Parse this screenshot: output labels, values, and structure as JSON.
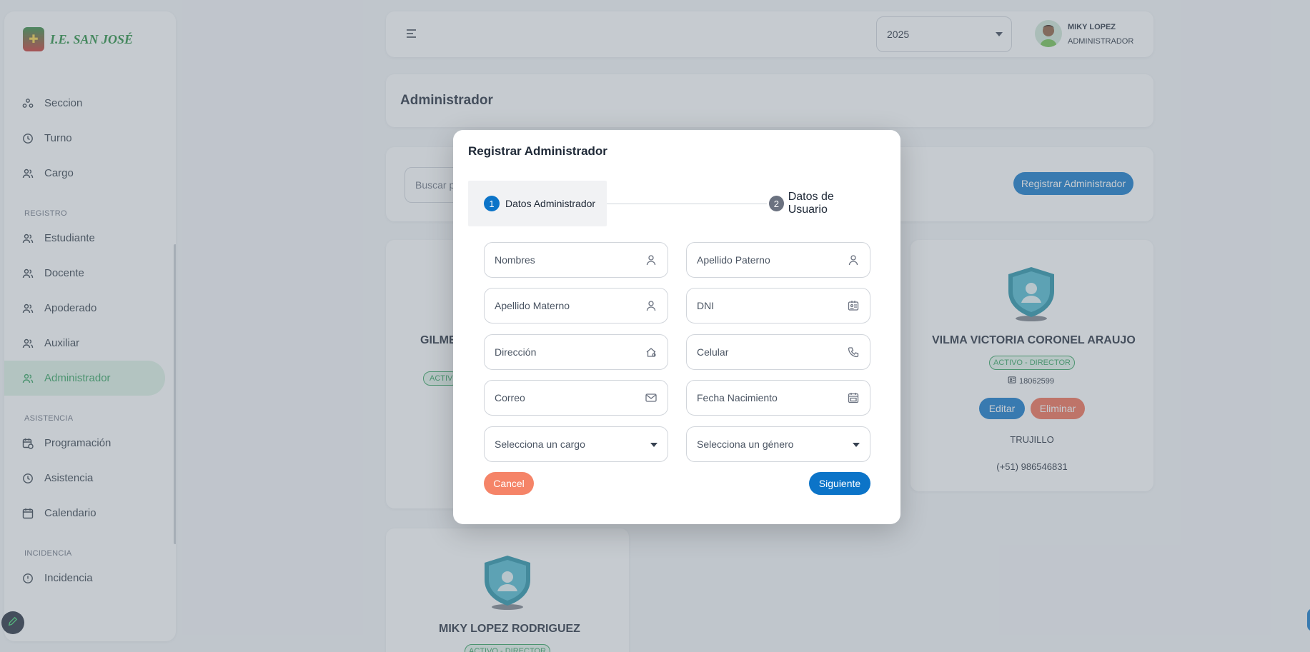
{
  "brand": {
    "name": "I.E. SAN JOSÉ"
  },
  "sidebar": {
    "items_top": [
      {
        "label": "Seccion",
        "icon": "section-icon"
      },
      {
        "label": "Turno",
        "icon": "clock-icon"
      },
      {
        "label": "Cargo",
        "icon": "users-icon"
      }
    ],
    "section_registro": "REGISTRO",
    "items_registro": [
      {
        "label": "Estudiante",
        "icon": "users-icon"
      },
      {
        "label": "Docente",
        "icon": "users-icon"
      },
      {
        "label": "Apoderado",
        "icon": "users-icon"
      },
      {
        "label": "Auxiliar",
        "icon": "users-icon"
      },
      {
        "label": "Administrador",
        "icon": "users-icon",
        "active": true
      }
    ],
    "section_asistencia": "ASISTENCIA",
    "items_asistencia": [
      {
        "label": "Programación",
        "icon": "calendar-clock-icon"
      },
      {
        "label": "Asistencia",
        "icon": "clock-icon"
      },
      {
        "label": "Calendario",
        "icon": "calendar-icon"
      }
    ],
    "section_incidencia": "INCIDENCIA",
    "items_incidencia": [
      {
        "label": "Incidencia",
        "icon": "alert-icon"
      }
    ]
  },
  "header": {
    "year": "2025",
    "user_name": "MIKY LOPEZ",
    "user_role": "ADMINISTRADOR"
  },
  "page": {
    "title": "Administrador",
    "search_placeholder": "Buscar por",
    "register_button": "Registrar Administrador"
  },
  "cards": [
    {
      "name": "GILME",
      "badge": "ACTIV"
    },
    {
      "name": "VILMA VICTORIA CORONEL ARAUJO",
      "badge": "ACTIVO - DIRECTOR",
      "dni": "18062599",
      "edit": "Editar",
      "delete": "Eliminar",
      "city": "TRUJILLO",
      "phone": "(+51) 986546831"
    },
    {
      "name": "MIKY LOPEZ RODRIGUEZ",
      "badge": "ACTIVO - DIRECTOR"
    }
  ],
  "modal": {
    "title": "Registrar Administrador",
    "step1": {
      "num": "1",
      "label": "Datos Administrador"
    },
    "step2": {
      "num": "2",
      "label": "Datos de Usuario"
    },
    "fields": {
      "nombres": "Nombres",
      "apellido_paterno": "Apellido Paterno",
      "apellido_materno": "Apellido Materno",
      "dni": "DNI",
      "direccion": "Dirección",
      "celular": "Celular",
      "correo": "Correo",
      "fecha_nacimiento": "Fecha Nacimiento",
      "cargo": "Selecciona un cargo",
      "genero": "Selecciona un género"
    },
    "cancel": "Cancel",
    "next": "Siguiente"
  },
  "colors": {
    "primary": "#0c74c8",
    "active_green": "#2ea05b",
    "cancel": "#f58468",
    "delete": "#f26a4f"
  }
}
